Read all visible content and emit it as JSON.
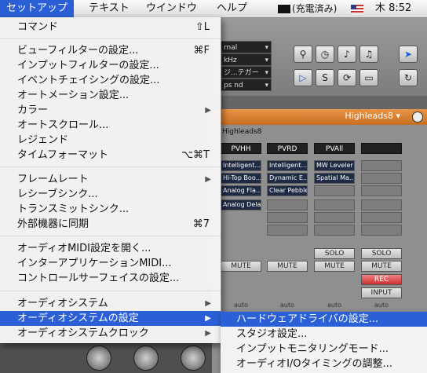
{
  "menubar": {
    "apple": "",
    "items": [
      "セットアップ",
      "テキスト",
      "ウインドウ",
      "ヘルプ"
    ],
    "battery": "(充電済み)",
    "clock": "木 8:52"
  },
  "menu": {
    "items": [
      {
        "label": "コマンド",
        "shortcut": "⇧L"
      },
      {
        "label": "ビューフィルターの設定...",
        "shortcut": "⌘F"
      },
      {
        "label": "インプットフィルターの設定..."
      },
      {
        "label": "イベントチェイシングの設定..."
      },
      {
        "label": "オートメーション設定..."
      },
      {
        "label": "カラー",
        "submenu": true
      },
      {
        "label": "オートスクロール..."
      },
      {
        "label": "レジェンド"
      },
      {
        "label": "タイムフォーマット",
        "shortcut": "⌥⌘T"
      },
      {
        "label": "フレームレート",
        "submenu": true
      },
      {
        "label": "レシーブシンク..."
      },
      {
        "label": "トランスミットシンク..."
      },
      {
        "label": "外部機器に同期",
        "shortcut": "⌘7"
      },
      {
        "label": "オーディオMIDI設定を開く..."
      },
      {
        "label": "インターアプリケーションMIDI..."
      },
      {
        "label": "コントロールサーフェイスの設定..."
      },
      {
        "label": "オーディオシステム",
        "submenu": true
      },
      {
        "label": "オーディオシステムの設定",
        "submenu": true,
        "selected": true
      },
      {
        "label": "オーディオシステムクロック",
        "submenu": true
      }
    ]
  },
  "submenu": {
    "items": [
      {
        "label": "ハードウェアドライバの設定...",
        "selected": true
      },
      {
        "label": "スタジオ設定..."
      },
      {
        "label": "インプットモニタリングモード..."
      },
      {
        "label": "オーディオI/Oタイミングの調整..."
      }
    ]
  },
  "app": {
    "toolbar_selects": [
      "rnal",
      "kHz",
      "ジ...テガー",
      "ps nd"
    ],
    "mixer_title": "Highleads8 ▾",
    "track_name": "Highleads8",
    "strips": [
      {
        "insert": "PVHH",
        "slots": [
          "Intelligent...",
          "Hi-Top Boo...",
          "Analog Fla...",
          "Analog Delay"
        ],
        "buttons": [
          "MUTE"
        ]
      },
      {
        "insert": "PVRD",
        "slots": [
          "Intelligent...",
          "Dynamic E...",
          "Clear Pebble"
        ],
        "buttons": [
          "MUTE"
        ]
      },
      {
        "insert": "PVAll",
        "slots": [
          "MW Leveler",
          "Spatial Ma..."
        ],
        "buttons": [
          "SOLO",
          "MUTE"
        ]
      },
      {
        "insert": "",
        "slots": [],
        "buttons": [
          "SOLO",
          "MUTE",
          "REC",
          "INPUT"
        ]
      }
    ],
    "auto_label": "auto"
  }
}
